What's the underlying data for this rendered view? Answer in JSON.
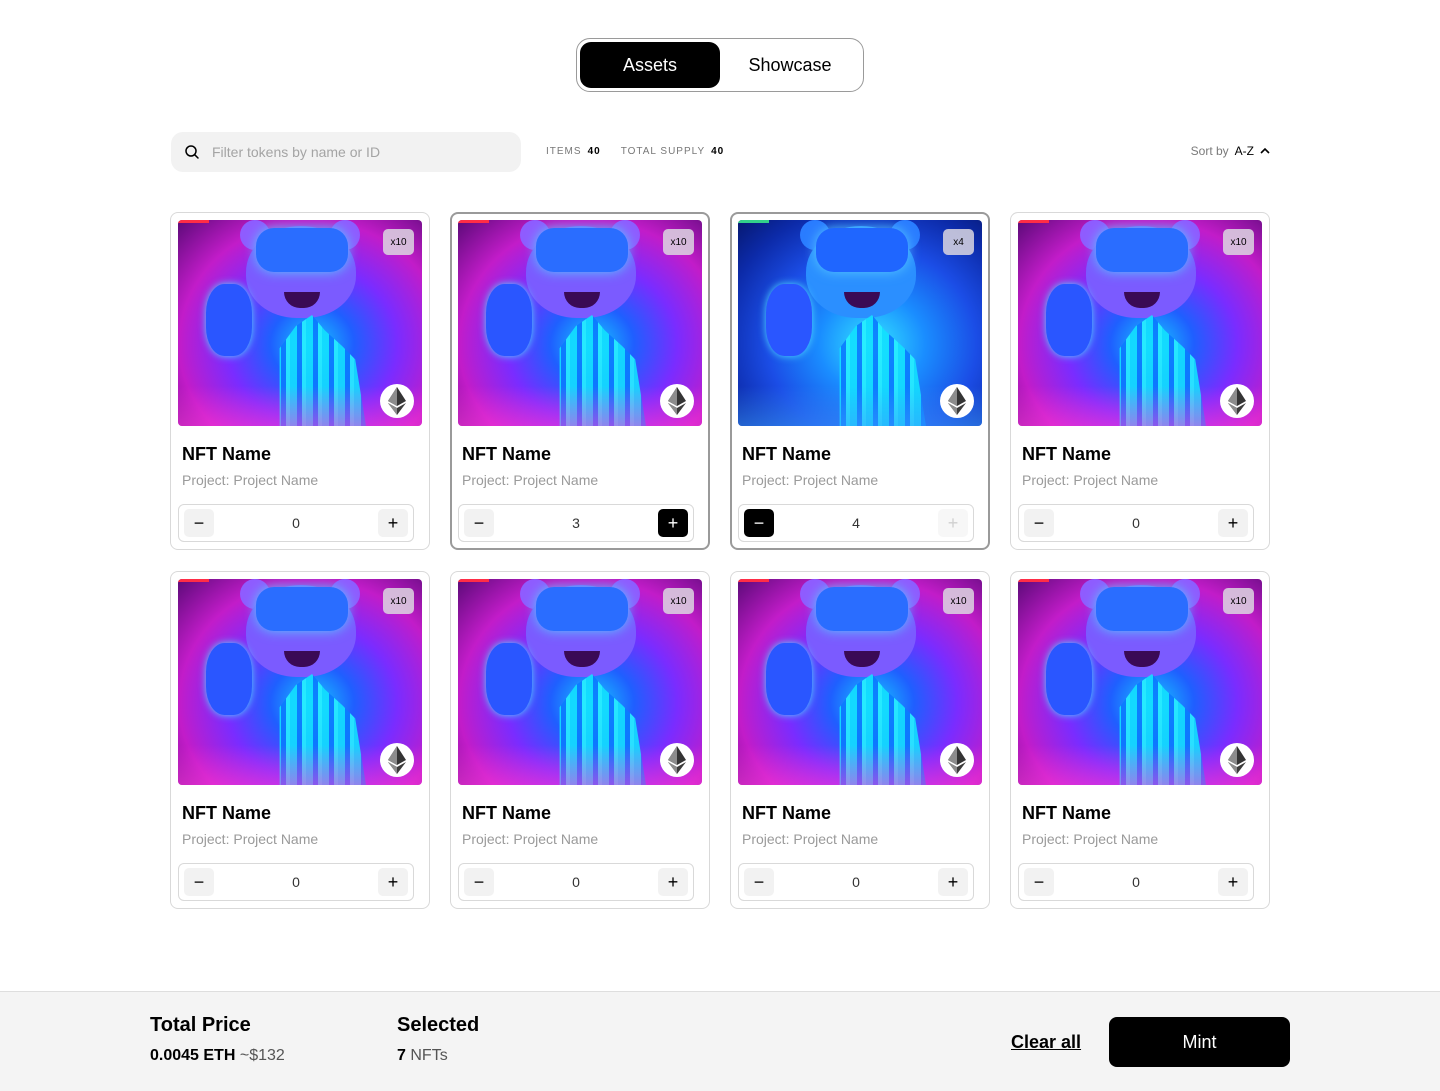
{
  "tabs": [
    {
      "label": "Assets",
      "active": true
    },
    {
      "label": "Showcase",
      "active": false
    }
  ],
  "search": {
    "placeholder": "Filter tokens by name or ID",
    "value": ""
  },
  "stats": {
    "items_label": "ITEMS",
    "items_value": "40",
    "supply_label": "TOTAL SUPPLY",
    "supply_value": "40"
  },
  "sort": {
    "label": "Sort by",
    "value": "A-Z"
  },
  "cards": [
    {
      "name": "NFT Name",
      "project": "Project: Project Name",
      "badge": "x10",
      "quantity": "0",
      "selected": false,
      "variant": "pink"
    },
    {
      "name": "NFT Name",
      "project": "Project: Project Name",
      "badge": "x10",
      "quantity": "3",
      "selected": true,
      "variant": "pink"
    },
    {
      "name": "NFT Name",
      "project": "Project: Project Name",
      "badge": "x4",
      "quantity": "4",
      "selected": true,
      "variant": "blue"
    },
    {
      "name": "NFT Name",
      "project": "Project: Project Name",
      "badge": "x10",
      "quantity": "0",
      "selected": false,
      "variant": "pink"
    },
    {
      "name": "NFT Name",
      "project": "Project: Project Name",
      "badge": "x10",
      "quantity": "0",
      "selected": false,
      "variant": "pink"
    },
    {
      "name": "NFT Name",
      "project": "Project: Project Name",
      "badge": "x10",
      "quantity": "0",
      "selected": false,
      "variant": "pink"
    },
    {
      "name": "NFT Name",
      "project": "Project: Project Name",
      "badge": "x10",
      "quantity": "0",
      "selected": false,
      "variant": "pink"
    },
    {
      "name": "NFT Name",
      "project": "Project: Project Name",
      "badge": "x10",
      "quantity": "0",
      "selected": false,
      "variant": "pink"
    }
  ],
  "footer": {
    "total_title": "Total Price",
    "total_eth": "0.0045 ETH",
    "total_usd": "~$132",
    "selected_title": "Selected",
    "selected_count": "7",
    "selected_unit": "NFTs",
    "clear_label": "Clear all",
    "mint_label": "Mint"
  },
  "icons": {
    "search": "search-icon",
    "sort": "chevron-up-icon",
    "chain": "ethereum-icon",
    "minus": "minus-icon",
    "plus": "plus-icon"
  },
  "colors": {
    "primary": "#000000",
    "background": "#ffffff",
    "footer_bg": "#f4f4f4"
  }
}
